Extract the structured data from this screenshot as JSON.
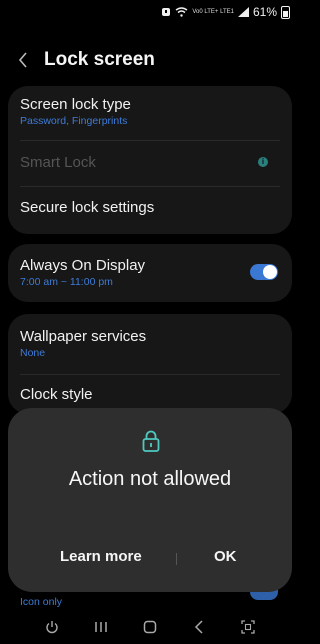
{
  "status": {
    "battery": "61%",
    "net": "Vo0 LTE+ LTE1"
  },
  "header": {
    "title": "Lock screen"
  },
  "group1": {
    "screen_lock_type": {
      "label": "Screen lock type",
      "sub": "Password, Fingerprints"
    },
    "smart_lock": {
      "label": "Smart Lock"
    },
    "secure_lock": {
      "label": "Secure lock settings"
    }
  },
  "group2": {
    "aod": {
      "label": "Always On Display",
      "sub": "7:00 am ~ 11:00 pm"
    }
  },
  "group3": {
    "wallpaper": {
      "label": "Wallpaper services",
      "sub": "None"
    },
    "clock": {
      "label": "Clock style"
    }
  },
  "peek": {
    "sub": "Icon only"
  },
  "dialog": {
    "message": "Action not allowed",
    "learn_more": "Learn more",
    "ok": "OK"
  },
  "colors": {
    "accent": "#3a78d4",
    "link": "#3e7bd6",
    "dialog_bg": "#2e2e2e",
    "card_bg": "#171717",
    "lock_icon": "#4fc9c0"
  }
}
